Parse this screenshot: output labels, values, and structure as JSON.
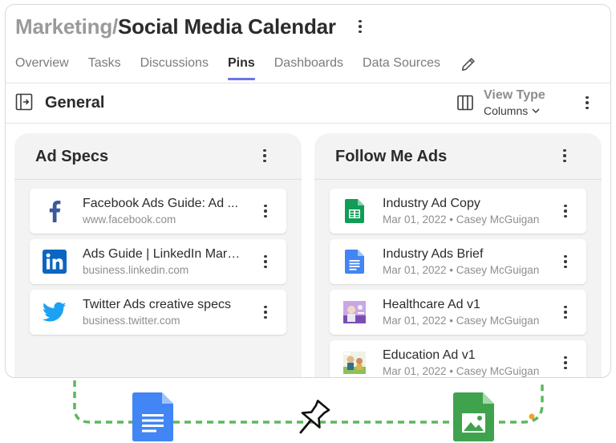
{
  "header": {
    "breadcrumb": "Marketing/",
    "title": "Social Media Calendar"
  },
  "tabs": [
    {
      "label": "Overview"
    },
    {
      "label": "Tasks"
    },
    {
      "label": "Discussions"
    },
    {
      "label": "Pins",
      "active": true
    },
    {
      "label": "Dashboards"
    },
    {
      "label": "Data Sources"
    }
  ],
  "toolbar": {
    "section_label": "General",
    "view_type_label": "View Type",
    "view_type_value": "Columns"
  },
  "columns": [
    {
      "title": "Ad Specs",
      "items": [
        {
          "icon": "facebook-icon",
          "title": "Facebook Ads Guide: Ad ...",
          "subtitle": "www.facebook.com"
        },
        {
          "icon": "linkedin-icon",
          "title": "Ads Guide | LinkedIn Mark...",
          "subtitle": "business.linkedin.com"
        },
        {
          "icon": "twitter-icon",
          "title": "Twitter Ads creative specs",
          "subtitle": "business.twitter.com"
        }
      ]
    },
    {
      "title": "Follow Me Ads",
      "items": [
        {
          "icon": "google-sheets-icon",
          "title": "Industry Ad Copy",
          "subtitle": "Mar 01, 2022 • Casey McGuigan"
        },
        {
          "icon": "google-docs-icon",
          "title": "Industry Ads Brief",
          "subtitle": "Mar 01, 2022 • Casey McGuigan"
        },
        {
          "icon": "image-thumbnail-icon",
          "title": "Healthcare Ad v1",
          "subtitle": "Mar 01, 2022 • Casey McGuigan"
        },
        {
          "icon": "image-thumbnail-icon",
          "title": "Education Ad v1",
          "subtitle": "Mar 01, 2022 • Casey McGuigan"
        }
      ]
    }
  ],
  "colors": {
    "accent": "#6b74e6",
    "facebook": "#3b5998",
    "linkedin": "#0a66c2",
    "twitter": "#1da1f2",
    "sheets": "#0f9d58",
    "docs": "#4285f4",
    "connector": "#5cb85c"
  }
}
